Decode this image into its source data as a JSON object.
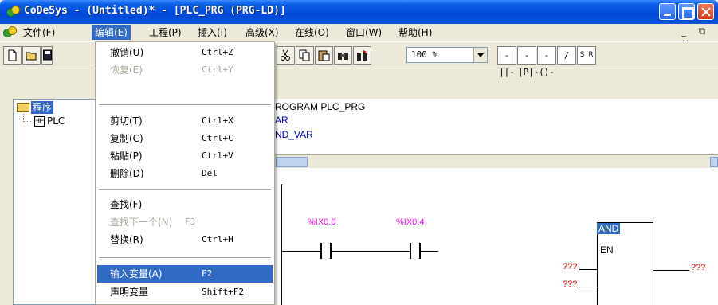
{
  "window": {
    "title": "CoDeSys - (Untitled)* - [PLC_PRG (PRG-LD)]"
  },
  "menubar": {
    "items": [
      "文件(F)",
      "编辑(E)",
      "工程(P)",
      "插入(I)",
      "高级(X)",
      "在线(O)",
      "窗口(W)",
      "帮助(H)"
    ],
    "mdi_controls": "_ ⧉ ×"
  },
  "toolbar": {
    "zoom_value": "100 %",
    "ld_buttons": [
      "-||-",
      "-|P|-",
      "-()-",
      "/",
      "S R"
    ]
  },
  "edit_menu": [
    {
      "label": "撤销(U)",
      "shortcut": "Ctrl+Z",
      "enabled": true
    },
    {
      "label": "恢复(E)",
      "shortcut": "Ctrl+Y",
      "enabled": false
    },
    {
      "label": "剪切(T)",
      "shortcut": "Ctrl+X",
      "enabled": true
    },
    {
      "label": "复制(C)",
      "shortcut": "Ctrl+C",
      "enabled": true
    },
    {
      "label": "粘贴(P)",
      "shortcut": "Ctrl+V",
      "enabled": true
    },
    {
      "label": "删除(D)",
      "shortcut": "Del",
      "enabled": true
    },
    {
      "label": "查找(F)",
      "shortcut": "",
      "enabled": true
    },
    {
      "label": "查找下一个(N)",
      "shortcut": "F3",
      "enabled": false
    },
    {
      "label": "替换(R)",
      "shortcut": "Ctrl+H",
      "enabled": true
    },
    {
      "label": "输入变量(A)",
      "shortcut": "F2",
      "enabled": true,
      "highlighted": true
    },
    {
      "label": "声明变量",
      "shortcut": "Shift+F2",
      "enabled": true
    }
  ],
  "tree": {
    "root": "程序",
    "child": "PLC"
  },
  "declaration": {
    "line1": "ROGRAM PLC_PRG",
    "line2": "AR",
    "line3": "ND_VAR"
  },
  "ladder": {
    "contact1": "%IX0.0",
    "contact2": "%IX0.4",
    "function_block": "AND",
    "fb_input_en": "EN",
    "unknown_input_1": "???",
    "unknown_input_2": "???",
    "unknown_output": "???"
  },
  "colors": {
    "titlebar": "#0048d8",
    "highlight": "#316ac5",
    "variable_label": "#ff00ff",
    "unknown_marker": "#e00000"
  }
}
